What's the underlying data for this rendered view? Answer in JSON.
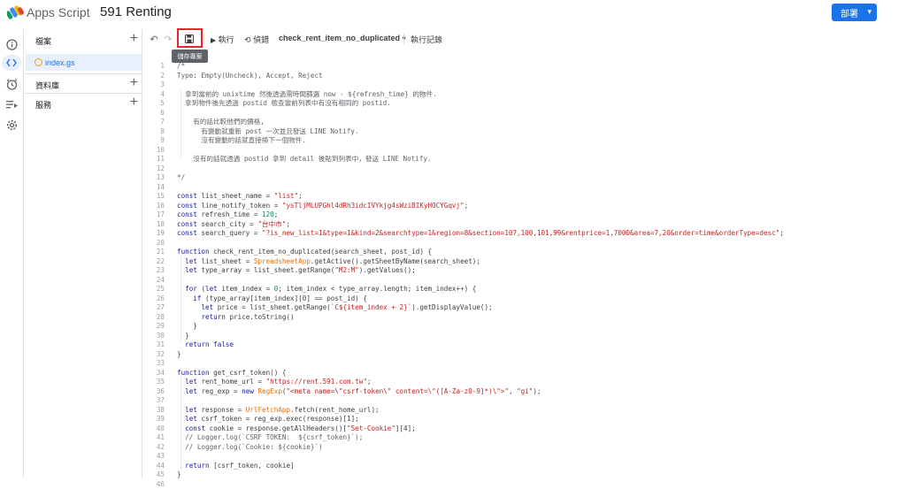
{
  "header": {
    "app_name": "Apps Script",
    "project_title": "591 Renting",
    "deploy_label": "部署"
  },
  "files_panel": {
    "files_label": "檔案",
    "file_name": "index.gs",
    "libraries_label": "資料庫",
    "services_label": "服務"
  },
  "toolbar": {
    "run_label": "執行",
    "debug_label": "偵錯",
    "function_select": "check_rent_item_no_duplicated",
    "log_label": "執行記錄",
    "save_tooltip": "儲存專案"
  },
  "code_lines": [
    "/*",
    "Type: Empty(Uncheck), Accept, Reject",
    "",
    "  拿到當前的 unixtime 然後透過需時間篩選 now - ${refresh_time} 的物件.",
    "  拿到物件後先透過 postid 檢查當前列表中有沒有相同的 postid.",
    "",
    "    有的話比較他們的價格,",
    "      有變動就重新 post 一次並且發送 LINE Notify.",
    "      沒有變動的話就直接換下一個物件.",
    "",
    "    沒有的話就透過 postid 拿到 detail 後貼到列表中，發送 LINE Notify.",
    "",
    "*/",
    "",
    "const list_sheet_name = \"list\";",
    "const line_notify_token = \"ysTljMLUPGhl4dRh3idcIVYkjg4sWziBIKyHOCYGqvj\";",
    "const refresh_time = 120;",
    "const search_city = \"台中市\";",
    "const search_query = \"?is_new_list=1&type=1&kind=2&searchtype=1&region=8&section=107,100,101,99&rentprice=1,7000&area=7,20&order=time&orderType=desc\";",
    "",
    "function check_rent_item_no_duplicated(search_sheet, post_id) {",
    "  let list_sheet = SpreadsheetApp.getActive().getSheetByName(search_sheet);",
    "  let type_array = list_sheet.getRange(\"M2:M\").getValues();",
    "",
    "  for (let item_index = 0; item_index < type_array.length; item_index++) {",
    "    if (type_array[item_index][0] == post_id) {",
    "      let price = list_sheet.getRange(`C${item_index + 2}`).getDisplayValue();",
    "      return price.toString()",
    "    }",
    "  }",
    "  return false",
    "}",
    "",
    "function get_csrf_token() {",
    "  let rent_home_url = \"https://rent.591.com.tw\";",
    "  let reg_exp = new RegExp(\"<meta name=\\\"csrf-token\\\" content=\\\"([A-Za-z0-9]*)\\\">\", \"gi\");",
    "",
    "  let response = UrlFetchApp.fetch(rent_home_url);",
    "  let csrf_token = reg_exp.exec(response)[1];",
    "  const cookie = response.getAllHeaders()[\"Set-Cookie\"][4];",
    "  // Logger.log(`CSRF TOKEN:  ${csrf_token}`);",
    "  // Logger.log(`Cookie: ${cookie}`)",
    "",
    "  return [csrf_token, cookie]",
    "}",
    ""
  ]
}
